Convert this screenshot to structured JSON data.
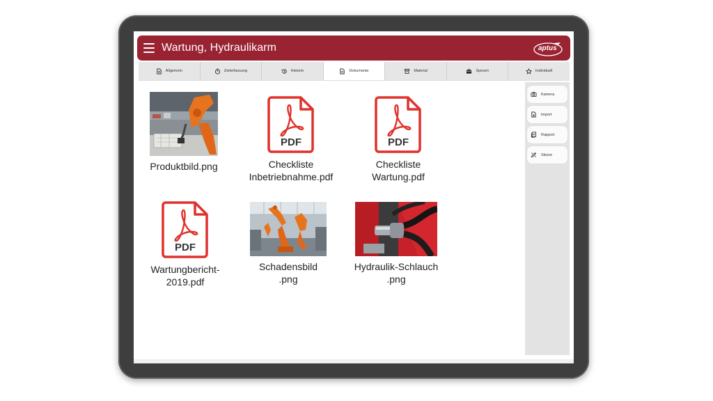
{
  "app": {
    "title": "Wartung, Hydraulikarm",
    "logo_text": "aptus"
  },
  "tabs": [
    {
      "label": "Allgemein",
      "icon": "document-icon",
      "active": false
    },
    {
      "label": "Zeiterfassung",
      "icon": "stopwatch-icon",
      "active": false
    },
    {
      "label": "Historie",
      "icon": "history-icon",
      "active": false
    },
    {
      "label": "Dokumente",
      "icon": "document-icon",
      "active": true
    },
    {
      "label": "Material",
      "icon": "material-icon",
      "active": false
    },
    {
      "label": "Spesen",
      "icon": "briefcase-icon",
      "active": false
    },
    {
      "label": "Individuell",
      "icon": "star-icon",
      "active": false
    }
  ],
  "files": [
    {
      "name": "Produktbild.png",
      "type": "image",
      "thumb": "robot-arm-photo"
    },
    {
      "name": "Checkliste\nInbetriebnahme.pdf",
      "type": "pdf",
      "icon_text": "PDF"
    },
    {
      "name": "Checkliste\nWartung.pdf",
      "type": "pdf",
      "icon_text": "PDF"
    },
    {
      "name": "Wartungbericht-\n2019.pdf",
      "type": "pdf",
      "icon_text": "PDF"
    },
    {
      "name": "Schadensbild\n.png",
      "type": "image",
      "thumb": "factory-robots-photo"
    },
    {
      "name": "Hydraulik-Schlauch\n.png",
      "type": "image",
      "thumb": "hydraulic-hose-photo"
    }
  ],
  "side_actions": [
    {
      "label": "Kamera",
      "icon": "camera-icon"
    },
    {
      "label": "Import",
      "icon": "import-icon"
    },
    {
      "label": "Rapport",
      "icon": "report-icon"
    },
    {
      "label": "Skizze",
      "icon": "sketch-icon"
    }
  ],
  "colors": {
    "brand": "#9a2332",
    "pdf_red": "#e0312b",
    "robot_orange": "#e8731e"
  }
}
